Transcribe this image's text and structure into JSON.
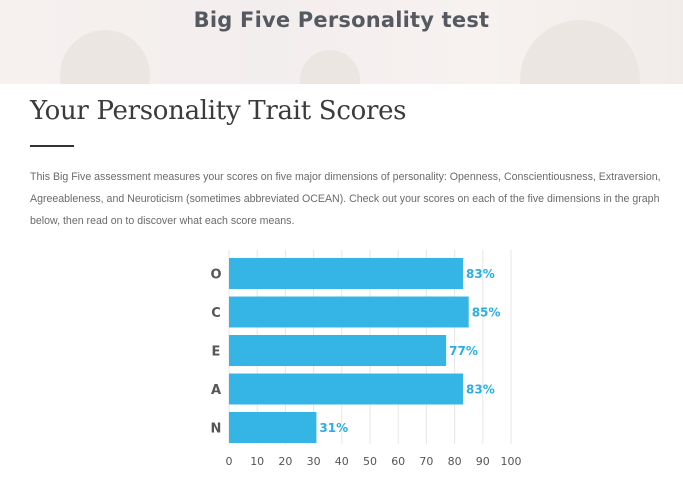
{
  "header": {
    "title": "Big Five Personality test"
  },
  "section": {
    "title": "Your Personality Trait Scores",
    "intro": "This Big Five assessment measures your scores on five major dimensions of personality: Openness, Conscientiousness, Extraversion, Agreeableness, and Neuroticism (sometimes abbreviated OCEAN). Check out your scores on each of the five dimensions in the graph below, then read on to discover what each score means."
  },
  "colors": {
    "bar": "#35b5e5",
    "label": "#2aaee3",
    "grid": "#e6e6e6"
  },
  "chart_data": {
    "type": "bar",
    "orientation": "horizontal",
    "categories": [
      "O",
      "C",
      "E",
      "A",
      "N"
    ],
    "values": [
      83,
      85,
      77,
      83,
      31
    ],
    "value_labels": [
      "83%",
      "85%",
      "77%",
      "83%",
      "31%"
    ],
    "xticks": [
      0,
      10,
      20,
      30,
      40,
      50,
      60,
      70,
      80,
      90,
      100
    ],
    "xlim": [
      0,
      100
    ],
    "grid": "vertical"
  }
}
